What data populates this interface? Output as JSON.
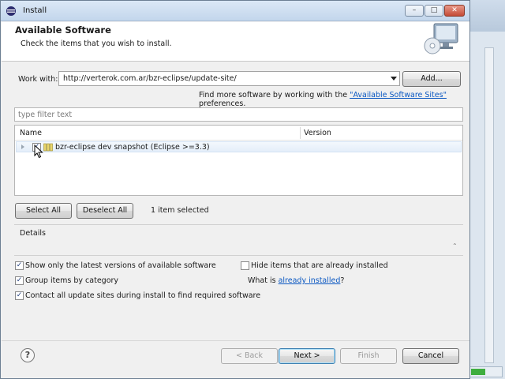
{
  "window": {
    "title": "Install",
    "minimize_glyph": "–",
    "maximize_glyph": "□",
    "close_glyph": "✕"
  },
  "header": {
    "title": "Available Software",
    "subtitle": "Check the items that you wish to install."
  },
  "work_with": {
    "label": "Work with:",
    "value": "http://verterok.com.ar/bzr-eclipse/update-site/",
    "add_button": "Add..."
  },
  "find_more": {
    "prefix": "Find more software by working with the ",
    "link": "\"Available Software Sites\"",
    "suffix": " preferences."
  },
  "filter": {
    "placeholder": "type filter text"
  },
  "tree": {
    "columns": [
      "Name",
      "Version"
    ],
    "rows": [
      {
        "name": "bzr-eclipse dev snapshot (Eclipse >=3.3)",
        "version": "",
        "checked": true,
        "check_glyph": "✓"
      }
    ]
  },
  "selection": {
    "select_all": "Select All",
    "deselect_all": "Deselect All",
    "status": "1 item selected"
  },
  "details": {
    "label": "Details",
    "scroll_glyph": "⌃"
  },
  "options": {
    "show_latest": {
      "label": "Show only the latest versions of available software",
      "checked": true
    },
    "group_by_category": {
      "label": "Group items by category",
      "checked": true
    },
    "contact_all_sites": {
      "label": "Contact all update sites during install to find required software",
      "checked": true
    },
    "hide_installed": {
      "label": "Hide items that are already installed",
      "checked": false
    },
    "check_glyph": "✓",
    "what_is_prefix": "What is ",
    "what_is_link": "already installed",
    "what_is_suffix": "?"
  },
  "footer": {
    "help_glyph": "?",
    "back": "< Back",
    "next": "Next >",
    "finish": "Finish",
    "cancel": "Cancel"
  }
}
